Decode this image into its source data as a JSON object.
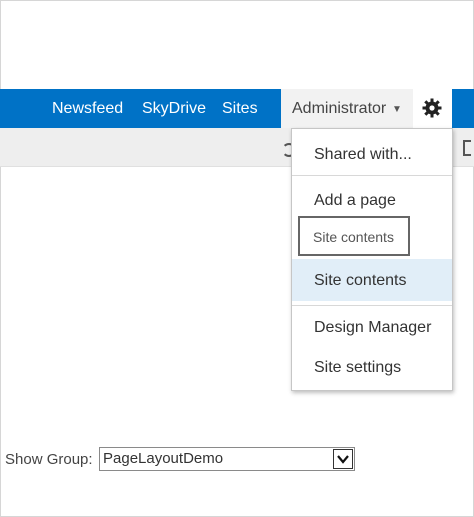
{
  "suite_bar": {
    "links": [
      "Newsfeed",
      "SkyDrive",
      "Sites"
    ],
    "user_menu_label": "Administrator",
    "accent_color": "#0072c6",
    "settings_icon": "gear-icon"
  },
  "settings_menu": {
    "items": [
      "Shared with...",
      "Add a page",
      "Site contents",
      "Design Manager",
      "Site settings"
    ],
    "highlighted_item": "Site contents"
  },
  "callout": {
    "label": "Site contents"
  },
  "show_group": {
    "label": "Show Group:",
    "selected_value": "PageLayoutDemo"
  }
}
